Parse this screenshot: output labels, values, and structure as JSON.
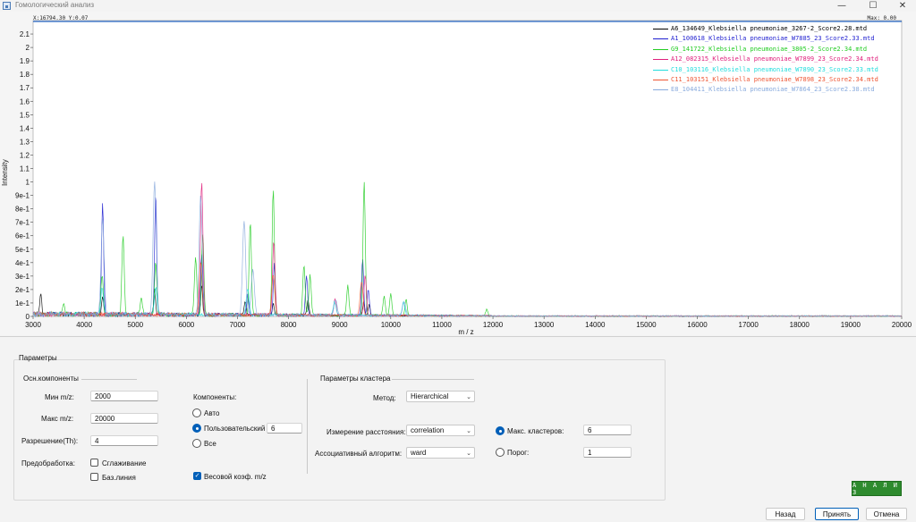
{
  "window": {
    "title": "Гомологический анализ",
    "minimize_glyph": "—",
    "maximize_glyph": "☐",
    "close_glyph": "✕"
  },
  "plot": {
    "coord_readout": "X:16794.30 Y:0.07",
    "max_readout": "Max: 0.00"
  },
  "chart_data": {
    "type": "line",
    "xlabel": "m / z",
    "ylabel": "Intensity",
    "xlim": [
      3000,
      20000
    ],
    "ylim": [
      0,
      2.2
    ],
    "x_ticks": [
      3000,
      4000,
      5000,
      6000,
      7000,
      8000,
      9000,
      10000,
      11000,
      12000,
      13000,
      14000,
      15000,
      16000,
      17000,
      18000,
      19000,
      20000
    ],
    "y_ticks": [
      {
        "value": 0,
        "label": "0"
      },
      {
        "value": 0.1,
        "label": "1e-1"
      },
      {
        "value": 0.2,
        "label": "2e-1"
      },
      {
        "value": 0.3,
        "label": "3e-1"
      },
      {
        "value": 0.4,
        "label": "4e-1"
      },
      {
        "value": 0.5,
        "label": "5e-1"
      },
      {
        "value": 0.6,
        "label": "6e-1"
      },
      {
        "value": 0.7,
        "label": "7e-1"
      },
      {
        "value": 0.8,
        "label": "8e-1"
      },
      {
        "value": 0.9,
        "label": "9e-1"
      },
      {
        "value": 1.0,
        "label": "1"
      },
      {
        "value": 1.1,
        "label": "1.1"
      },
      {
        "value": 1.2,
        "label": "1.2"
      },
      {
        "value": 1.3,
        "label": "1.3"
      },
      {
        "value": 1.4,
        "label": "1.4"
      },
      {
        "value": 1.5,
        "label": "1.5"
      },
      {
        "value": 1.6,
        "label": "1.6"
      },
      {
        "value": 1.7,
        "label": "1.7"
      },
      {
        "value": 1.8,
        "label": "1.8"
      },
      {
        "value": 1.9,
        "label": "1.9"
      },
      {
        "value": 2.0,
        "label": "2"
      },
      {
        "value": 2.1,
        "label": "2.1"
      }
    ],
    "legend_position": "top-right",
    "grid": false,
    "series": [
      {
        "name": "A6_134649_Klebsiella pneumoniae_3267-2_Score2.28.mtd",
        "color": "#000000",
        "peaks": [
          [
            3150,
            0.15
          ],
          [
            4360,
            0.12
          ],
          [
            5380,
            0.18
          ],
          [
            6300,
            0.22
          ],
          [
            7150,
            0.1
          ],
          [
            7700,
            0.08
          ],
          [
            8380,
            0.12
          ],
          [
            9470,
            0.1
          ],
          [
            9580,
            0.08
          ]
        ]
      },
      {
        "name": "A1_100618_Klebsiella pneumoniae_W7885_23_Score2.33.mtd",
        "color": "#1f1fd0",
        "peaks": [
          [
            4360,
            0.84
          ],
          [
            5400,
            0.9
          ],
          [
            6300,
            0.45
          ],
          [
            7200,
            0.15
          ],
          [
            7720,
            0.38
          ],
          [
            8350,
            0.3
          ],
          [
            9450,
            0.42
          ],
          [
            9560,
            0.2
          ]
        ]
      },
      {
        "name": "G9_141722_Klebsiella pneumoniae_3805-2_Score2.34.mtd",
        "color": "#22cc22",
        "peaks": [
          [
            3600,
            0.08
          ],
          [
            4350,
            0.3
          ],
          [
            4760,
            0.6
          ],
          [
            5120,
            0.12
          ],
          [
            5400,
            0.4
          ],
          [
            6180,
            0.44
          ],
          [
            6320,
            0.6
          ],
          [
            7250,
            0.7
          ],
          [
            7700,
            0.94
          ],
          [
            8300,
            0.38
          ],
          [
            8420,
            0.3
          ],
          [
            9160,
            0.22
          ],
          [
            9480,
            1.0
          ],
          [
            9870,
            0.14
          ],
          [
            10000,
            0.16
          ],
          [
            10300,
            0.12
          ],
          [
            11880,
            0.05
          ]
        ]
      },
      {
        "name": "A12_082315_Klebsiella pneumoniae_W7899_23_Score2.34.mtd",
        "color": "#e0207c",
        "peaks": [
          [
            6300,
            1.0
          ],
          [
            7710,
            0.55
          ],
          [
            8910,
            0.12
          ],
          [
            9500,
            0.3
          ]
        ]
      },
      {
        "name": "C10_103116_Klebsiella pneumoniae_W7890_23_Score2.33.mtd",
        "color": "#22dddd",
        "peaks": [
          [
            4350,
            0.2
          ],
          [
            5400,
            0.2
          ],
          [
            7200,
            0.2
          ],
          [
            8900,
            0.1
          ],
          [
            10250,
            0.1
          ]
        ]
      },
      {
        "name": "C11_103151_Klebsiella pneumoniae_W7898_23_Score2.34.mtd",
        "color": "#ee5533",
        "peaks": [
          [
            6280,
            0.4
          ],
          [
            7700,
            0.3
          ],
          [
            9430,
            0.25
          ]
        ]
      },
      {
        "name": "E8_104411_Klebsiella pneumoniae_W7864_23_Score2.38.mtd",
        "color": "#88aadd",
        "peaks": [
          [
            4360,
            0.7
          ],
          [
            5380,
            1.0
          ],
          [
            6280,
            0.88
          ],
          [
            7130,
            0.7
          ],
          [
            7300,
            0.34
          ],
          [
            8920,
            0.12
          ],
          [
            10260,
            0.1
          ]
        ]
      }
    ]
  },
  "params": {
    "title": "Параметры",
    "main_section": "Осн.компоненты",
    "min_mz_label": "Мин m/z:",
    "min_mz_value": "2000",
    "max_mz_label": "Макс m/z:",
    "max_mz_value": "20000",
    "resolution_label": "Разрешение(Th):",
    "resolution_value": "4",
    "preprocessing_label": "Предобработка:",
    "smoothing_label": "Сглаживание",
    "baseline_label": "Баз.линия",
    "components_label": "Компоненты:",
    "auto_label": "Авто",
    "custom_label": "Пользовательский",
    "custom_value": "6",
    "all_label": "Все",
    "weight_label": "Весовой коэф. m/z",
    "cluster_section": "Параметры кластера",
    "method_label": "Метод:",
    "method_value": "Hierarchical",
    "distance_label": "Измерение расстояния:",
    "distance_value": "correlation",
    "assoc_label": "Ассоциативный алгоритм:",
    "assoc_value": "ward",
    "max_clusters_label": "Макс. кластеров:",
    "max_clusters_value": "6",
    "threshold_label": "Порог:",
    "threshold_value": "1"
  },
  "buttons": {
    "analyze": "А Н А Л И З",
    "back": "Назад",
    "accept": "Принять",
    "cancel": "Отмена"
  }
}
